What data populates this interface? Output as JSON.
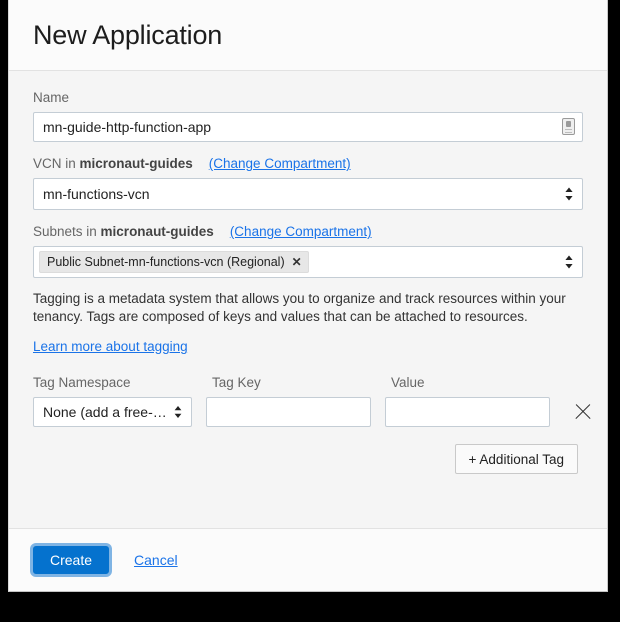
{
  "dialog": {
    "title": "New Application"
  },
  "name_field": {
    "label": "Name",
    "value": "mn-guide-http-function-app",
    "placeholder": "",
    "icon": "input-assist-icon"
  },
  "vcn_field": {
    "label_prefix": "VCN in ",
    "label_compartment": "micronaut-guides",
    "change_link": "(Change Compartment)",
    "selected": "mn-functions-vcn"
  },
  "subnets_field": {
    "label_prefix": "Subnets in ",
    "label_compartment": "micronaut-guides",
    "change_link": "(Change Compartment)",
    "chips": [
      {
        "label": "Public Subnet-mn-functions-vcn (Regional)",
        "remove": "✕"
      }
    ]
  },
  "tagging": {
    "description": "Tagging is a metadata system that allows you to organize and track resources within your tenancy. Tags are composed of keys and values that can be attached to resources.",
    "learn_more": "Learn more about tagging",
    "columns": {
      "namespace": "Tag Namespace",
      "key": "Tag Key",
      "value": "Value"
    },
    "row": {
      "namespace_selected": "None (add a free-…",
      "key_value": "",
      "key_placeholder": "",
      "value_value": "",
      "value_placeholder": "",
      "remove_icon": "close-icon"
    },
    "additional_tag_button": "+ Additional Tag"
  },
  "footer": {
    "create_label": "Create",
    "cancel_label": "Cancel"
  },
  "colors": {
    "primary": "#0572ce",
    "link": "#1a73e8",
    "focus_ring": "#7fb4e4",
    "body_bg": "#f5f5f5",
    "panel_bg": "#fbfbfb",
    "chip_bg": "#e7e7e7",
    "border": "#c4cdd5"
  }
}
